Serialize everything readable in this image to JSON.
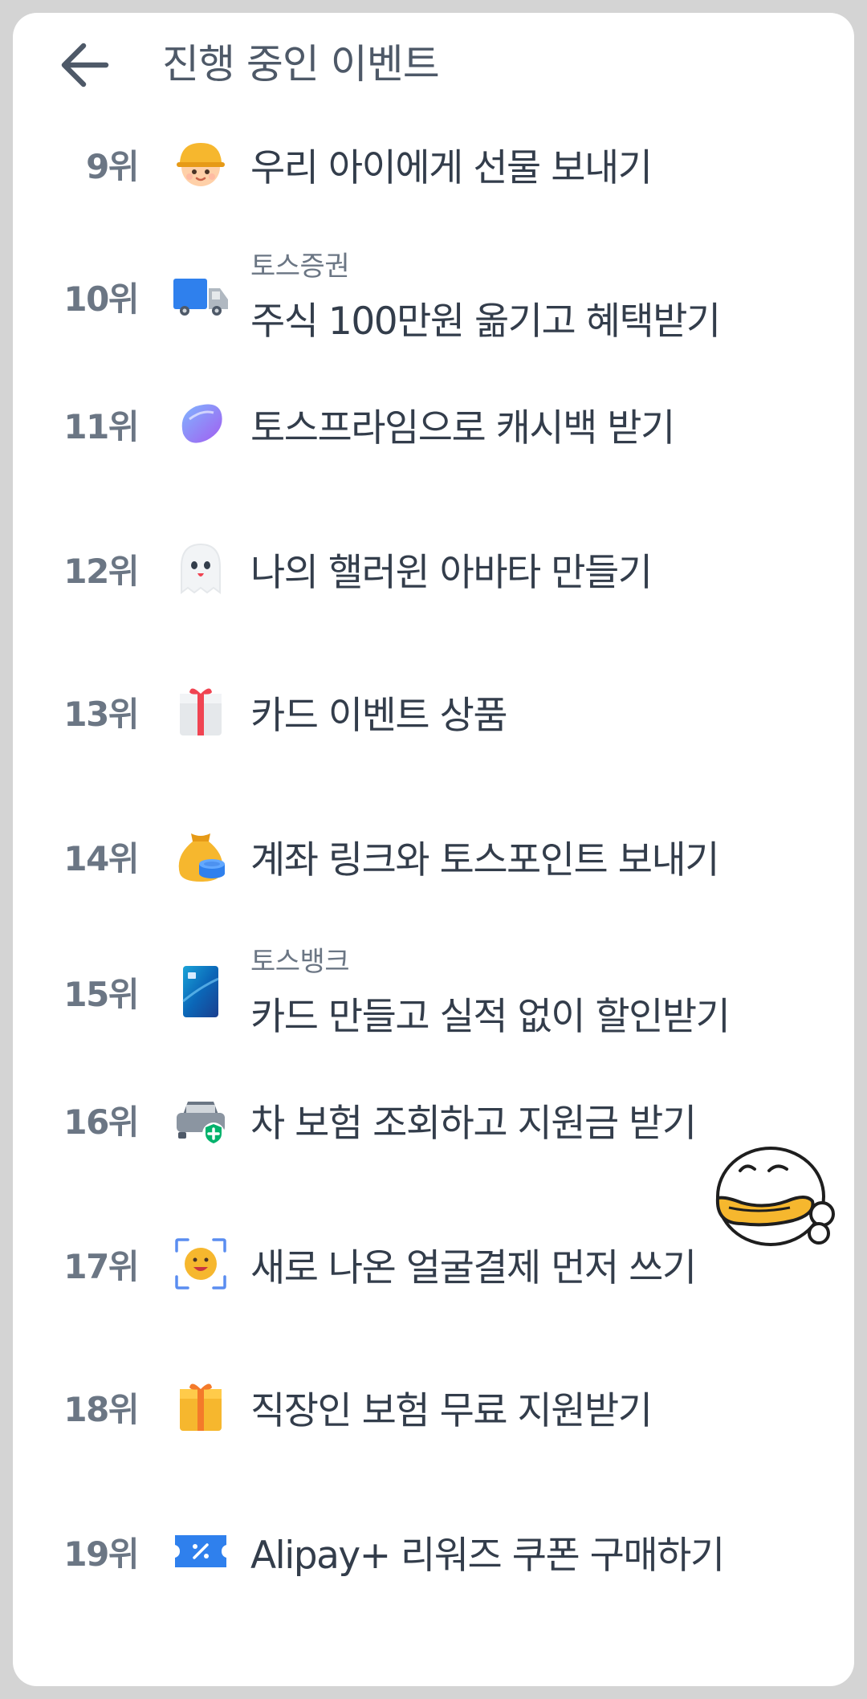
{
  "header": {
    "back_icon": "arrow-left-icon",
    "title": "진행 중인 이벤트"
  },
  "events": [
    {
      "rank": "9위",
      "sub": "",
      "label": "우리 아이에게 선물 보내기",
      "icon": "child-face-icon"
    },
    {
      "rank": "10위",
      "sub": "토스증권",
      "label": "주식 100만원 옮기고 혜택받기",
      "icon": "truck-icon"
    },
    {
      "rank": "11위",
      "sub": "",
      "label": "토스프라임으로 캐시백 받기",
      "icon": "toss-prime-icon"
    },
    {
      "rank": "12위",
      "sub": "",
      "label": "나의 핼러윈 아바타 만들기",
      "icon": "ghost-icon"
    },
    {
      "rank": "13위",
      "sub": "",
      "label": "카드 이벤트 상품",
      "icon": "gift-box-white-icon"
    },
    {
      "rank": "14위",
      "sub": "",
      "label": "계좌 링크와 토스포인트 보내기",
      "icon": "money-bag-icon"
    },
    {
      "rank": "15위",
      "sub": "토스뱅크",
      "label": "카드 만들고 실적 없이 할인받기",
      "icon": "card-icon"
    },
    {
      "rank": "16위",
      "sub": "",
      "label": "차 보험 조회하고 지원금 받기",
      "icon": "car-insurance-icon"
    },
    {
      "rank": "17위",
      "sub": "",
      "label": "새로 나온 얼굴결제 먼저 쓰기",
      "icon": "face-scan-icon"
    },
    {
      "rank": "18위",
      "sub": "",
      "label": "직장인 보험 무료 지원받기",
      "icon": "gift-box-yellow-icon"
    },
    {
      "rank": "19위",
      "sub": "",
      "label": "Alipay+ 리워즈 쿠폰 구매하기",
      "icon": "coupon-icon"
    }
  ],
  "sticker": {
    "icon": "duck-character-sticker-icon"
  },
  "colors": {
    "rank": "#6b7684",
    "label": "#333d4b",
    "sub": "#6b7684",
    "title": "#4e5968"
  }
}
